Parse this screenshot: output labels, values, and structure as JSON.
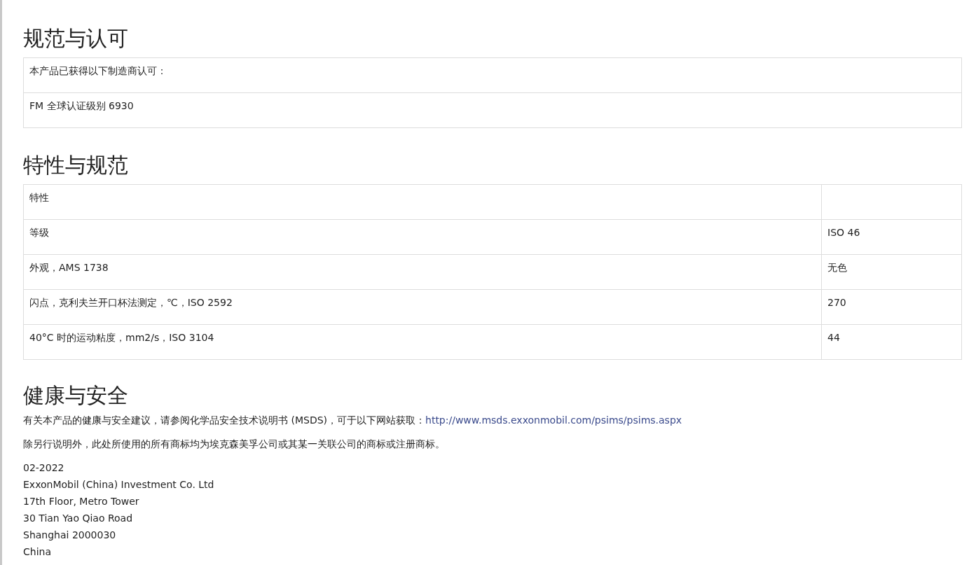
{
  "approvals": {
    "heading": "规范与认可",
    "rows": [
      "本产品已获得以下制造商认可：",
      "FM 全球认证级别 6930"
    ]
  },
  "properties": {
    "heading": "特性与规范",
    "rows": [
      [
        "特性",
        ""
      ],
      [
        "等级",
        "ISO 46"
      ],
      [
        "外观，AMS 1738",
        "无色"
      ],
      [
        "闪点，克利夫兰开口杯法测定，℃，ISO 2592",
        "270"
      ],
      [
        "40°C 时的运动粘度，mm2/s，ISO 3104",
        "44"
      ]
    ]
  },
  "health": {
    "heading": "健康与安全",
    "advice": {
      "text": "有关本产品的健康与安全建议，请参阅化学品安全技术说明书 (MSDS)，可于以下网站获取：",
      "link": "http://www.msds.exxonmobil.com/psims/psims.aspx"
    },
    "trademark": "除另行说明外，此处所使用的所有商标均为埃克森美孚公司或其某一关联公司的商标或注册商标。",
    "address": [
      "02-2022",
      "ExxonMobil (China) Investment Co. Ltd",
      "17th Floor, Metro Tower",
      "30 Tian Yao Qiao Road",
      "Shanghai 2000030",
      "China"
    ]
  }
}
